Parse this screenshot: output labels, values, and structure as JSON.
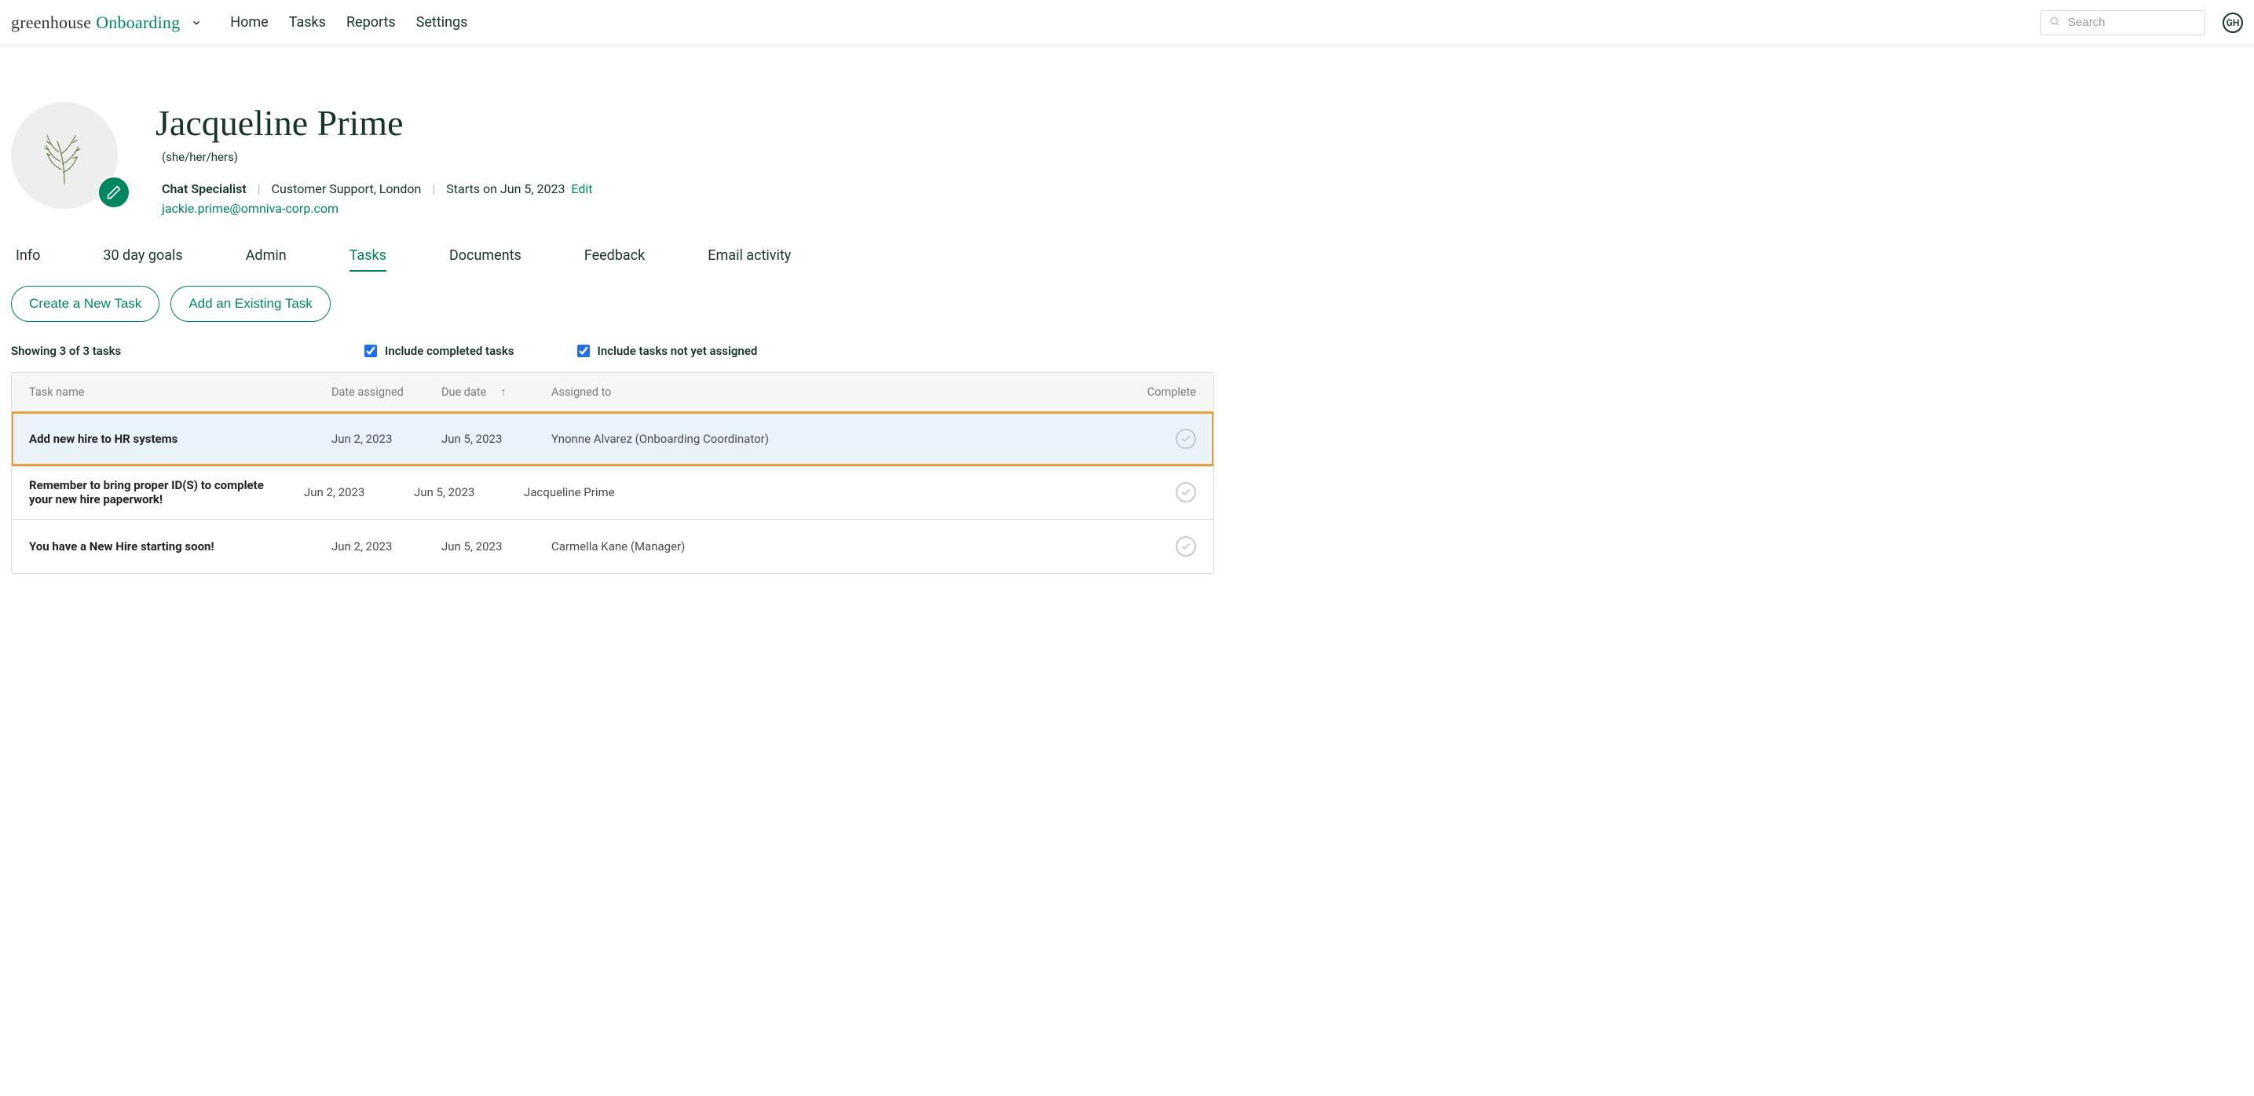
{
  "brand": {
    "word1": "greenhouse",
    "word2": "Onboarding"
  },
  "topnav": {
    "home": "Home",
    "tasks": "Tasks",
    "reports": "Reports",
    "settings": "Settings"
  },
  "search": {
    "placeholder": "Search"
  },
  "user_badge": "GH",
  "profile": {
    "name": "Jacqueline Prime",
    "pronouns": "(she/her/hers)",
    "role": "Chat Specialist",
    "department": "Customer Support, London",
    "start_text": "Starts on Jun 5, 2023",
    "edit_label": "Edit",
    "email": "jackie.prime@omniva-corp.com"
  },
  "tabs": {
    "info": "Info",
    "goals": "30 day goals",
    "admin": "Admin",
    "tasks": "Tasks",
    "documents": "Documents",
    "feedback": "Feedback",
    "email_activity": "Email activity"
  },
  "buttons": {
    "create_task": "Create a New Task",
    "add_existing": "Add an Existing Task"
  },
  "filters": {
    "showing": "Showing 3 of 3 tasks",
    "include_completed": "Include completed tasks",
    "include_unassigned": "Include tasks not yet assigned"
  },
  "columns": {
    "task_name": "Task name",
    "date_assigned": "Date assigned",
    "due_date": "Due date",
    "assigned_to": "Assigned to",
    "complete": "Complete"
  },
  "rows": [
    {
      "name": "Add new hire to HR systems",
      "date_assigned": "Jun 2, 2023",
      "due_date": "Jun 5, 2023",
      "assigned_to": "Ynonne Alvarez (Onboarding Coordinator)",
      "highlight": true
    },
    {
      "name": "Remember to bring proper ID(S) to complete your new hire paperwork!",
      "date_assigned": "Jun 2, 2023",
      "due_date": "Jun 5, 2023",
      "assigned_to": "Jacqueline Prime",
      "highlight": false
    },
    {
      "name": "You have a New Hire starting soon!",
      "date_assigned": "Jun 2, 2023",
      "due_date": "Jun 5, 2023",
      "assigned_to": "Carmella Kane (Manager)",
      "highlight": false
    }
  ]
}
